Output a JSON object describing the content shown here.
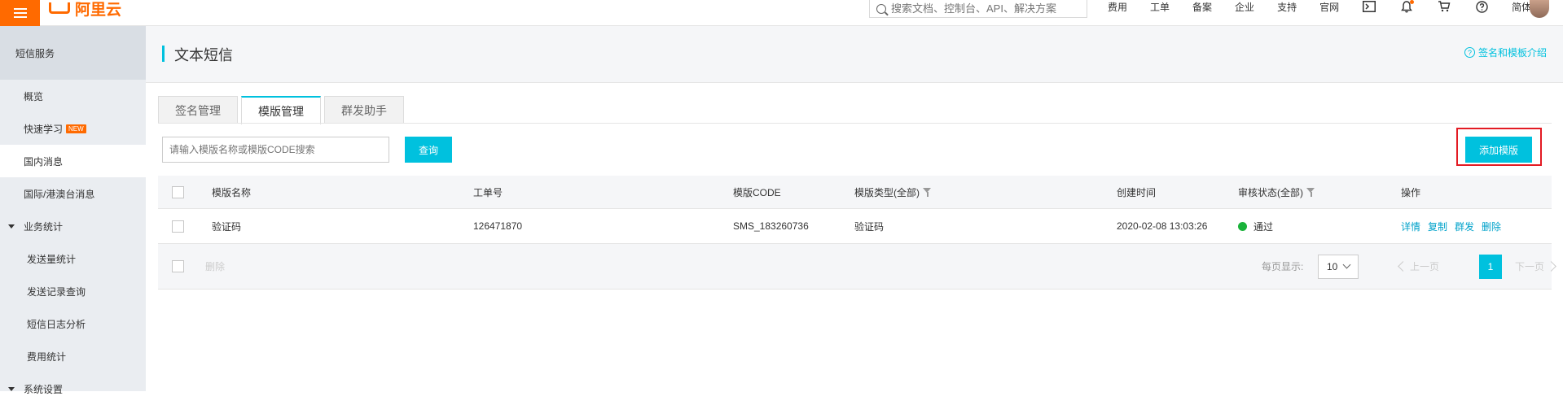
{
  "topbar": {
    "logo_text": "阿里云",
    "search_placeholder": "搜索文档、控制台、API、解决方案",
    "nav": [
      "费用",
      "工单",
      "备案",
      "企业",
      "支持",
      "官网"
    ],
    "lang": "简体"
  },
  "sidebar": {
    "header": "短信服务",
    "items": [
      {
        "label": "概览"
      },
      {
        "label": "快速学习",
        "badge": "NEW"
      },
      {
        "label": "国内消息"
      },
      {
        "label": "国际/港澳台消息"
      }
    ],
    "group_stats": "业务统计",
    "stats_items": [
      "发送量统计",
      "发送记录查询",
      "短信日志分析",
      "费用统计"
    ],
    "group_settings": "系统设置"
  },
  "page": {
    "title": "文本短信",
    "help_link": "签名和模板介绍"
  },
  "tabs": [
    {
      "label": "签名管理"
    },
    {
      "label": "模版管理"
    },
    {
      "label": "群发助手"
    }
  ],
  "filter": {
    "placeholder": "请输入模版名称或模版CODE搜索",
    "query_label": "查询",
    "add_label": "添加模版"
  },
  "table": {
    "columns": {
      "name": "模版名称",
      "ticket": "工单号",
      "code": "模版CODE",
      "type": "模版类型(全部)",
      "created": "创建时间",
      "status": "审核状态(全部)",
      "ops": "操作"
    },
    "rows": [
      {
        "name": "验证码",
        "ticket": "126471870",
        "code": "SMS_183260736",
        "type": "验证码",
        "created": "2020-02-08 13:03:26",
        "status": "通过",
        "ops": [
          "详情",
          "复制",
          "群发",
          "删除"
        ]
      }
    ],
    "footer": {
      "delete_label": "删除",
      "page_size_label": "每页显示:",
      "page_size": "10",
      "prev": "上一页",
      "current_page": "1",
      "next": "下一页"
    }
  },
  "colors": {
    "accent": "#00c1de",
    "brand": "#ff6a00",
    "highlight_border": "#e31b23",
    "status_ok": "#1ab23a"
  }
}
